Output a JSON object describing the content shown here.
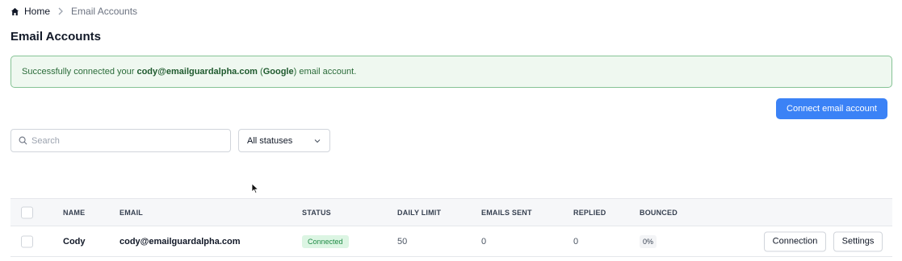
{
  "breadcrumb": {
    "home_label": "Home",
    "current_label": "Email Accounts",
    "home_icon": "home-icon",
    "separator_icon": "chevron-right-icon"
  },
  "page": {
    "title": "Email Accounts"
  },
  "alert": {
    "prefix": "Successfully connected your ",
    "email": "cody@emailguardalpha.com",
    "provider_open": " (",
    "provider": "Google",
    "provider_close": ")",
    "suffix": " email account.",
    "color": "#eff8f0"
  },
  "toolbar": {
    "connect_label": "Connect email account",
    "accent_color": "#3b82f6",
    "search_placeholder": "Search",
    "search_value": "",
    "status_filter": "All statuses"
  },
  "table": {
    "columns": [
      "NAME",
      "EMAIL",
      "STATUS",
      "DAILY LIMIT",
      "EMAILS SENT",
      "REPLIED",
      "BOUNCED"
    ],
    "rows": [
      {
        "name": "Cody",
        "email": "cody@emailguardalpha.com",
        "status": "Connected",
        "daily_limit": "50",
        "emails_sent": "0",
        "replied": "0",
        "bounced": "0%",
        "connection_label": "Connection",
        "settings_label": "Settings"
      }
    ]
  }
}
